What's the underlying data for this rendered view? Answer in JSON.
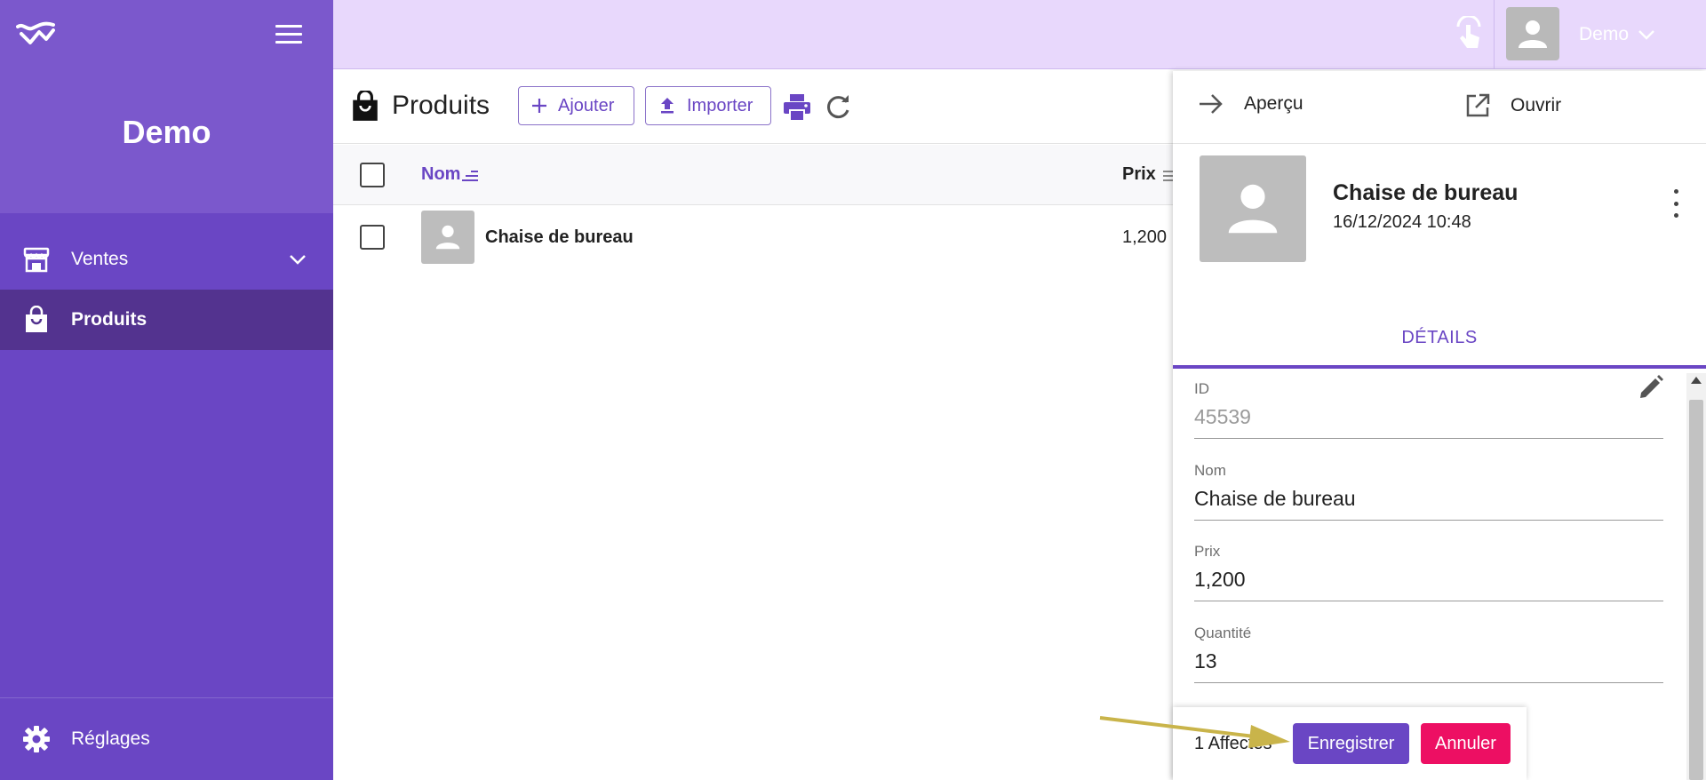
{
  "sidebar": {
    "brand": "Demo",
    "items": [
      {
        "label": "Ventes",
        "icon": "store-icon"
      },
      {
        "label": "Produits",
        "icon": "shopping-bag-icon"
      }
    ],
    "settings_label": "Réglages"
  },
  "topbar": {
    "user_name": "Demo"
  },
  "toolbar": {
    "title": "Produits",
    "add_label": "Ajouter",
    "import_label": "Importer"
  },
  "table": {
    "columns": [
      "Nom",
      "Prix"
    ],
    "rows": [
      {
        "name": "Chaise de bureau",
        "price": "1,200"
      }
    ]
  },
  "panel": {
    "apercu_label": "Aperçu",
    "ouvrir_label": "Ouvrir",
    "card_title": "Chaise de bureau",
    "card_date": "16/12/2024 10:48",
    "tab_label": "DÉTAILS",
    "fields": [
      {
        "label": "ID",
        "value": "45539"
      },
      {
        "label": "Nom",
        "value": "Chaise de bureau"
      },
      {
        "label": "Prix",
        "value": "1,200"
      },
      {
        "label": "Quantité",
        "value": "13"
      }
    ]
  },
  "savebar": {
    "affected": "1 Affectés",
    "save_label": "Enregistrer",
    "cancel_label": "Annuler"
  },
  "colors": {
    "sidebar": "#6a46c4",
    "sidebar_active": "#53338f",
    "topbar": "#e8d8fc",
    "accent": "#6a46c4",
    "cancel": "#ed0f63",
    "annotation_arrow": "#c9b44a"
  }
}
